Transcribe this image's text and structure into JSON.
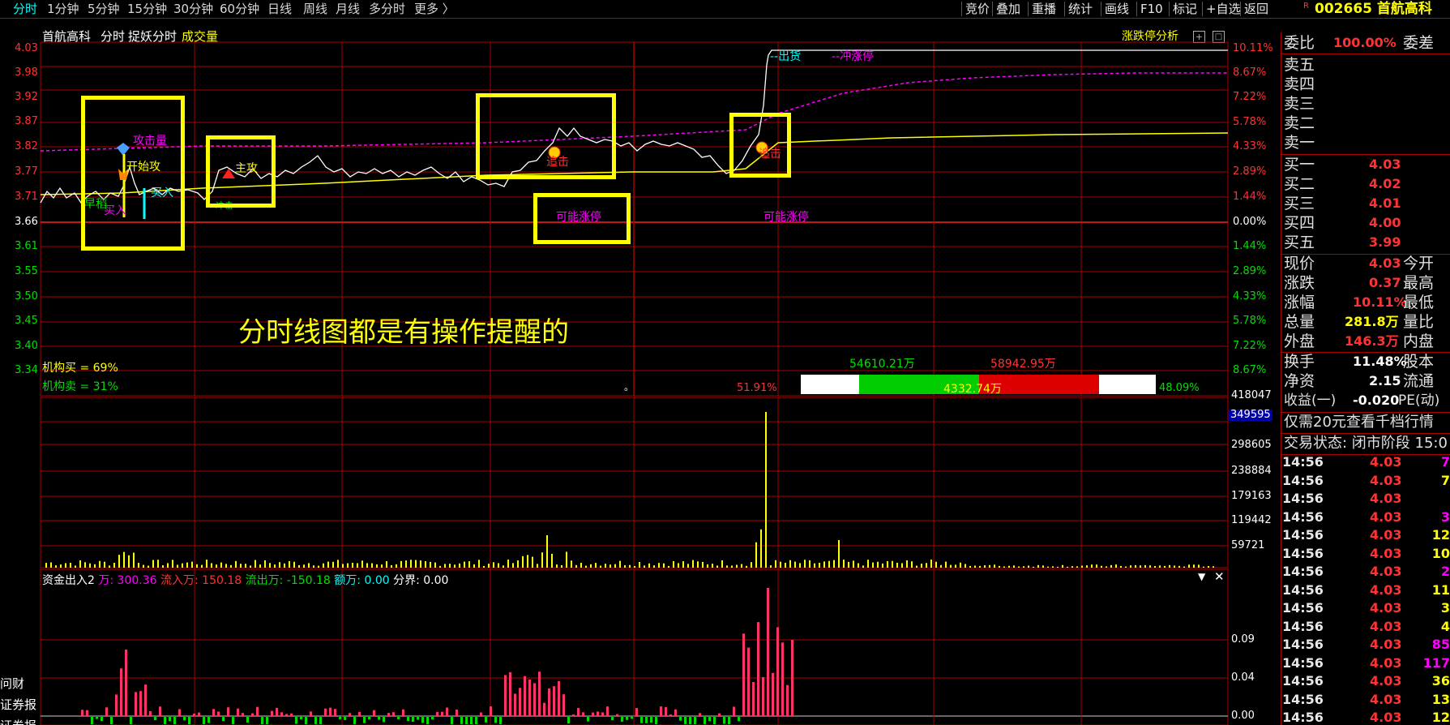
{
  "topbar": {
    "tabs": [
      "分时",
      "1分钟",
      "5分钟",
      "15分钟",
      "30分钟",
      "60分钟",
      "日线",
      "周线",
      "月线",
      "多分时",
      "更多 〉"
    ],
    "right_buttons": [
      "竞价",
      "叠加",
      "重播",
      "统计",
      "画线",
      "F10",
      "标记",
      "+自选",
      "返回"
    ],
    "stock_code": "002665",
    "stock_name": "首航高科",
    "r_mark": "R"
  },
  "chart_header": {
    "stock_name": "首航高科",
    "mode": "分时",
    "indicator": "捉妖分时",
    "volume_label": "成交量",
    "analysis_label": "涨跌停分析"
  },
  "price_axis": {
    "left": [
      "4.03",
      "3.98",
      "3.92",
      "3.87",
      "3.82",
      "3.77",
      "3.71",
      "3.66",
      "3.61",
      "3.55",
      "3.50",
      "3.45",
      "3.40",
      "3.34"
    ],
    "right": [
      "10.11%",
      "8.67%",
      "7.22%",
      "5.78%",
      "4.33%",
      "2.89%",
      "1.44%",
      "0.00%",
      "1.44%",
      "2.89%",
      "4.33%",
      "5.78%",
      "7.22%",
      "8.67%"
    ]
  },
  "volume_axis": [
    "418047",
    "349595",
    "298605",
    "238884",
    "179163",
    "119442",
    "59721"
  ],
  "volume_highlight": "349595",
  "fund_axis": [
    "0.09",
    "0.04",
    "0.00"
  ],
  "signals": {
    "attack_volume": "攻击量",
    "start_attack": "开始攻",
    "main_attack": "主攻",
    "chase1": "追击",
    "chase2": "追击",
    "maybe_limit1": "可能涨停",
    "maybe_limit2": "可能涨停",
    "chujiao": "--出货",
    "rush_limit": "--冲涨停",
    "buy_mark": "买入",
    "buy_mark2": "买入",
    "left_green": "早稻",
    "t2": "冲击"
  },
  "annotation": "分时线图都是有操作提醒的",
  "inst": {
    "buy": "机构买 = 69%",
    "sell": "机构卖 = 31%"
  },
  "flow_bar": {
    "left_val": "54610.21万",
    "right_val": "58942.95万",
    "center_val": "4332.74万",
    "left_pct": "51.91%",
    "right_pct": "48.09%",
    "dot": "。"
  },
  "fund_header": {
    "name": "资金出入2",
    "wan_label": "万:",
    "wan": "300.36",
    "in_label": "流入万:",
    "in": "150.18",
    "out_label": "流出万:",
    "out": "-150.18",
    "amt_label": "额万:",
    "amt": "0.00",
    "bound_label": "分界:",
    "bound": "0.00"
  },
  "left_edge": [
    "问财",
    "证券报",
    "证券报"
  ],
  "orderbook": {
    "wei_bi_label": "委比",
    "wei_bi": "100.00%",
    "wei_cha_label": "委差",
    "sells": [
      "卖五",
      "卖四",
      "卖三",
      "卖二",
      "卖一"
    ],
    "buys": [
      {
        "label": "买一",
        "price": "4.03"
      },
      {
        "label": "买二",
        "price": "4.02"
      },
      {
        "label": "买三",
        "price": "4.01"
      },
      {
        "label": "买四",
        "price": "4.00"
      },
      {
        "label": "买五",
        "price": "3.99"
      }
    ]
  },
  "quote": [
    {
      "l": "现价",
      "v": "4.03",
      "r": "今开",
      "c": "#ff3333"
    },
    {
      "l": "涨跌",
      "v": "0.37",
      "r": "最高",
      "c": "#ff3333"
    },
    {
      "l": "涨幅",
      "v": "10.11%",
      "r": "最低",
      "c": "#ff3333"
    },
    {
      "l": "总量",
      "v": "281.8万",
      "r": "量比",
      "c": "#ffff00"
    },
    {
      "l": "外盘",
      "v": "146.3万",
      "r": "内盘",
      "c": "#ff3333"
    },
    {
      "l": "换手",
      "v": "11.48%",
      "r": "股本",
      "c": "#e0e0e0"
    },
    {
      "l": "净资",
      "v": "2.15",
      "r": "流通",
      "c": "#e0e0e0"
    },
    {
      "l": "收益(一)",
      "v": "-0.020",
      "r": "PE(动)",
      "c": "#e0e0e0"
    }
  ],
  "promo": "仅需20元查看千档行情",
  "trade_status": "交易状态: 闭市阶段 15:0",
  "ticks": [
    {
      "t": "14:56",
      "p": "4.03",
      "v": "7",
      "c": "#ff00ff"
    },
    {
      "t": "14:56",
      "p": "4.03",
      "v": "7",
      "c": "#ffff00"
    },
    {
      "t": "14:56",
      "p": "4.03",
      "v": "",
      "c": "#ff00ff"
    },
    {
      "t": "14:56",
      "p": "4.03",
      "v": "3",
      "c": "#ff00ff"
    },
    {
      "t": "14:56",
      "p": "4.03",
      "v": "12",
      "c": "#ffff00"
    },
    {
      "t": "14:56",
      "p": "4.03",
      "v": "10",
      "c": "#ffff00"
    },
    {
      "t": "14:56",
      "p": "4.03",
      "v": "2",
      "c": "#ff00ff"
    },
    {
      "t": "14:56",
      "p": "4.03",
      "v": "11",
      "c": "#ffff00"
    },
    {
      "t": "14:56",
      "p": "4.03",
      "v": "3",
      "c": "#ffff00"
    },
    {
      "t": "14:56",
      "p": "4.03",
      "v": "4",
      "c": "#ffff00"
    },
    {
      "t": "14:56",
      "p": "4.03",
      "v": "85",
      "c": "#ff00ff"
    },
    {
      "t": "14:56",
      "p": "4.03",
      "v": "117",
      "c": "#ff00ff"
    },
    {
      "t": "14:56",
      "p": "4.03",
      "v": "36",
      "c": "#ffff00"
    },
    {
      "t": "14:56",
      "p": "4.03",
      "v": "13",
      "c": "#ffff00"
    },
    {
      "t": "14:56",
      "p": "4.03",
      "v": "12",
      "c": "#ffff00"
    }
  ],
  "colors": {
    "up": "#ff3333",
    "down": "#00e000",
    "grid": "#aa0000",
    "accent": "#ffff00"
  }
}
